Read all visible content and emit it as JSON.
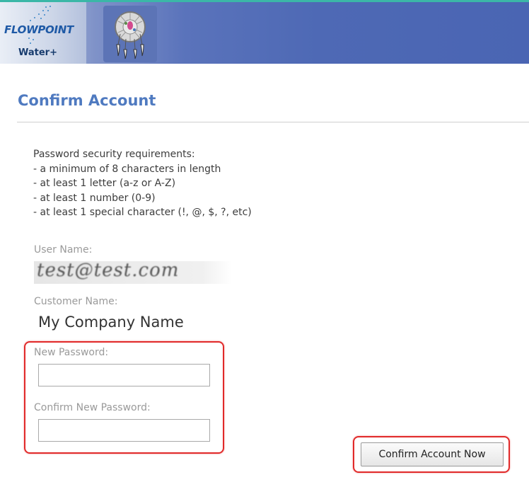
{
  "header": {
    "brand": "FLOWPOINT",
    "brand_sub": "Water+",
    "emblem_icon": "dreamcatcher-icon",
    "colors": {
      "banner": "#4e69b5",
      "accent_line": "#3bb7a7"
    }
  },
  "page": {
    "title": "Confirm Account",
    "title_color": "#4f7ac0"
  },
  "requirements": {
    "heading": "Password security requirements:",
    "items": [
      "- a minimum of 8 characters in length",
      "- at least 1 letter (a-z or A-Z)",
      "- at least 1 number (0-9)",
      "- at least 1 special character (!, @, $, ?, etc)"
    ]
  },
  "form": {
    "user_name_label": "User Name:",
    "user_name_value": "test@test.com",
    "customer_name_label": "Customer Name:",
    "customer_name_value": "My Company Name",
    "new_password_label": "New Password:",
    "new_password_value": "",
    "confirm_password_label": "Confirm New Password:",
    "confirm_password_value": "",
    "submit_label": "Confirm Account Now",
    "highlight_color": "#e12a2a"
  }
}
